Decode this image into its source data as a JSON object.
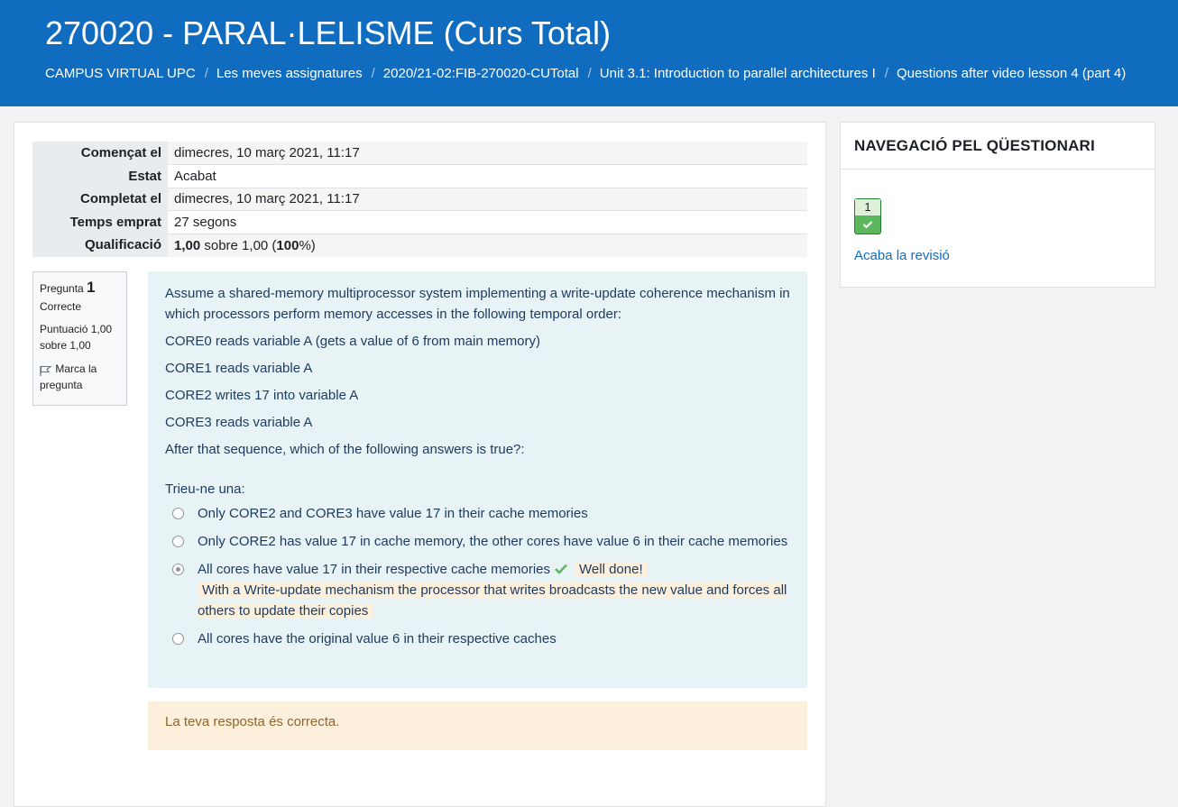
{
  "header": {
    "title": "270020 - PARAL·LELISME (Curs Total)",
    "breadcrumb": [
      "CAMPUS VIRTUAL UPC",
      "Les meves assignatures",
      "2020/21-02:FIB-270020-CUTotal",
      "Unit 3.1: Introduction to parallel architectures I",
      "Questions after video lesson 4 (part 4)"
    ]
  },
  "summary": {
    "started_label": "Començat el",
    "started_value": "dimecres, 10 març 2021, 11:17",
    "state_label": "Estat",
    "state_value": "Acabat",
    "completed_label": "Completat el",
    "completed_value": "dimecres, 10 març 2021, 11:17",
    "time_label": "Temps emprat",
    "time_value": "27 segons",
    "grade_label": "Qualificació",
    "grade_score": "1,00",
    "grade_mid": " sobre 1,00 (",
    "grade_percent": "100",
    "grade_end": "%)"
  },
  "question_info": {
    "label": "Pregunta",
    "number": "1",
    "state": "Correcte",
    "grade": "Puntuació 1,00 sobre 1,00",
    "flag_label": "Marca la pregunta"
  },
  "question": {
    "text": "Assume a shared-memory multiprocessor system implementing a write-update coherence mechanism in which processors perform memory accesses in the following temporal order:",
    "lines": [
      "CORE0 reads variable A (gets a value of 6 from main memory)",
      "CORE1 reads variable A",
      "CORE2 writes 17 into variable A",
      "CORE3 reads variable A",
      "After that sequence, which of the following answers is true?:"
    ],
    "prompt": "Trieu-ne una:",
    "answers": [
      "Only CORE2 and CORE3 have value 17 in their cache memories",
      "Only CORE2 has value 17 in cache memory, the other cores have value 6 in their cache memories",
      "All cores have value 17 in their respective cache memories",
      "All cores have the original value 6 in their respective caches"
    ],
    "selected_index": 2,
    "feedback_title": "Well done!",
    "feedback_text": "With a Write-update mechanism the processor that writes broadcasts the new value and forces all others to update their copies"
  },
  "outcome": "La teva resposta és correcta.",
  "nav": {
    "title": "NAVEGACIÓ PEL QÜESTIONARI",
    "button_number": "1",
    "finish_link": "Acaba la revisió"
  },
  "colors": {
    "header_bg": "#0f6cbf",
    "formulation_bg": "#e7f3f5",
    "outcome_bg": "#fcefdc",
    "correct_green": "#5cb85c"
  },
  "icons": {
    "flag": "flag-icon",
    "check": "check-icon"
  }
}
